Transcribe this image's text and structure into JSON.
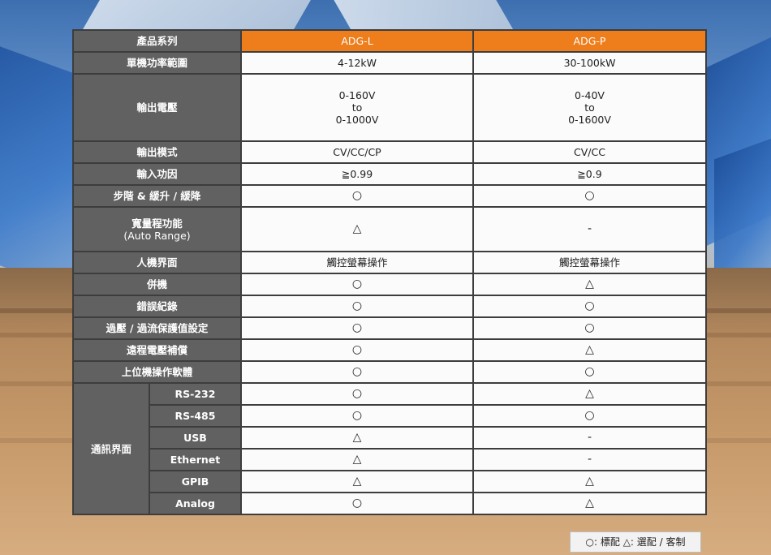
{
  "colors": {
    "header_bg": "#616161",
    "brand_orange": "#ee7d1b",
    "cell_bg": "#fbfbfb",
    "border": "#3d3d3d"
  },
  "table": {
    "header": {
      "label": "產品系列",
      "col1": "ADG-L",
      "col2": "ADG-P"
    },
    "power_range": {
      "label": "單機功率範圍",
      "col1": "4-12kW",
      "col2": "30-100kW"
    },
    "output_voltage": {
      "label": "輸出電壓",
      "col1": [
        "0-160V",
        "to",
        "0-1000V"
      ],
      "col2": [
        "0-40V",
        "to",
        "0-1600V"
      ]
    },
    "output_mode": {
      "label": "輸出模式",
      "col1": "CV/CC/CP",
      "col2": "CV/CC"
    },
    "power_factor": {
      "label": "輸入功因",
      "col1": "≧0.99",
      "col2": "≧0.9"
    },
    "step_slope": {
      "label": "步階 & 緩升 / 緩降",
      "col1": "○",
      "col2": "○"
    },
    "auto_range": {
      "label_line1": "寬量程功能",
      "label_line2": "(Auto Range)",
      "col1": "△",
      "col2": "-"
    },
    "hmi": {
      "label": "人機界面",
      "col1": "觸控螢幕操作",
      "col2": "觸控螢幕操作"
    },
    "parallel": {
      "label": "併機",
      "col1": "○",
      "col2": "△"
    },
    "error_log": {
      "label": "錯誤紀錄",
      "col1": "○",
      "col2": "○"
    },
    "ovp_ocp": {
      "label": "過壓 / 過流保護值設定",
      "col1": "○",
      "col2": "○"
    },
    "remote_sense": {
      "label": "遠程電壓補償",
      "col1": "○",
      "col2": "△"
    },
    "pc_software": {
      "label": "上位機操作軟體",
      "col1": "○",
      "col2": "○"
    },
    "comm": {
      "label": "通訊界面",
      "rows": [
        {
          "name": "RS-232",
          "col1": "○",
          "col2": "△"
        },
        {
          "name": "RS-485",
          "col1": "○",
          "col2": "○"
        },
        {
          "name": "USB",
          "col1": "△",
          "col2": "-"
        },
        {
          "name": "Ethernet",
          "col1": "△",
          "col2": "-"
        },
        {
          "name": "GPIB",
          "col1": "△",
          "col2": "△"
        },
        {
          "name": "Analog",
          "col1": "○",
          "col2": "△"
        }
      ]
    }
  },
  "legend": {
    "text": "○: 標配  △: 選配 / 客制"
  }
}
